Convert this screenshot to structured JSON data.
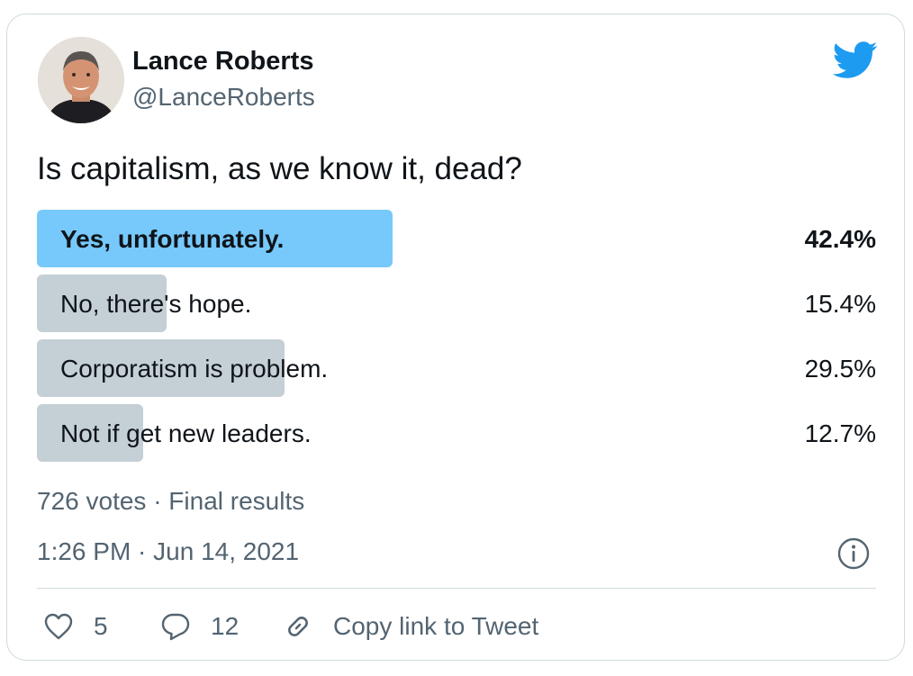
{
  "tweet": {
    "author_name": "Lance Roberts",
    "author_handle": "@LanceRoberts",
    "question": "Is capitalism, as we know it, dead?",
    "poll": {
      "options": [
        {
          "label": "Yes, unfortunately.",
          "percent": 42.4,
          "percent_text": "42.4%",
          "winner": true
        },
        {
          "label": "No, there's hope.",
          "percent": 15.4,
          "percent_text": "15.4%",
          "winner": false
        },
        {
          "label": "Corporatism is problem.",
          "percent": 29.5,
          "percent_text": "29.5%",
          "winner": false
        },
        {
          "label": "Not if get new leaders.",
          "percent": 12.7,
          "percent_text": "12.7%",
          "winner": false
        }
      ],
      "summary": "726 votes · Final results"
    },
    "timestamp": "1:26 PM · Jun 14, 2021",
    "actions": {
      "likes": "5",
      "replies": "12",
      "copy_link": "Copy link to Tweet"
    }
  },
  "colors": {
    "winner_bar": "#77c9fc",
    "other_bar": "#c4cfd6",
    "twitter_blue": "#1d9bf0",
    "secondary_text": "#536471"
  },
  "icons": [
    "avatar-photo",
    "twitter-bird-icon",
    "info-icon",
    "heart-icon",
    "reply-icon",
    "link-icon"
  ]
}
